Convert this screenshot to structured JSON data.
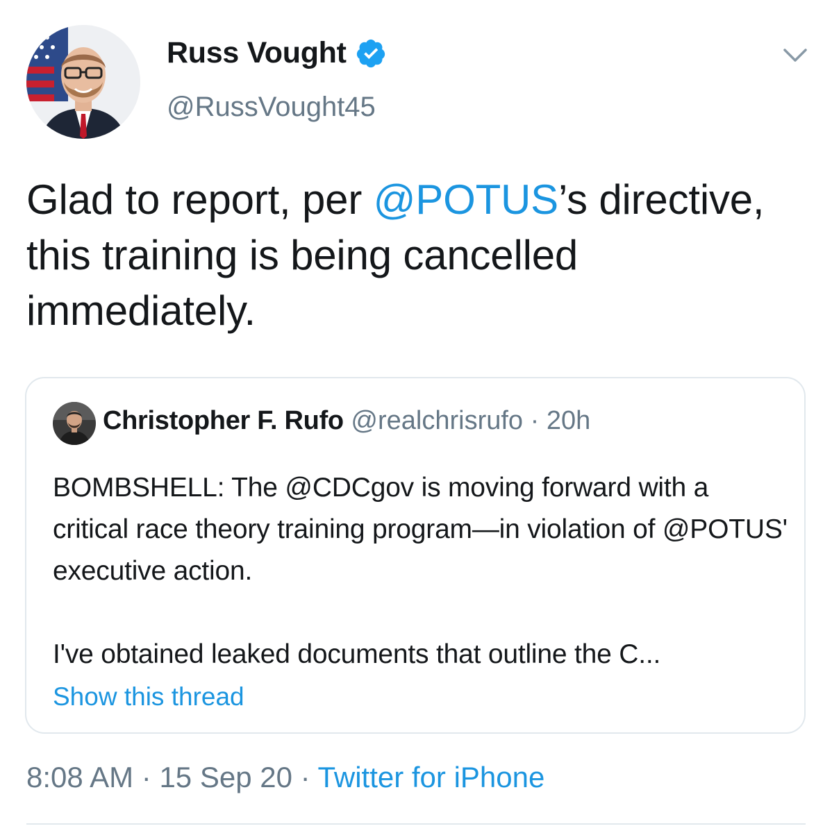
{
  "author": {
    "display_name": "Russ Vought",
    "handle": "@RussVought45",
    "verified_icon": "verified-badge-icon",
    "verified_color": "#1da1f2"
  },
  "tweet": {
    "text_before": "Glad to report, per ",
    "mention": "@POTUS",
    "text_after": "’s directive, this training is being cancelled immediately."
  },
  "quoted_tweet": {
    "display_name": "Christopher F. Rufo",
    "handle": "@realchrisrufo",
    "separator": "·",
    "time": "20h",
    "paragraph1": "BOMBSHELL: The @CDCgov is moving forward with a critical race theory training program—in violation of @POTUS' executive action.",
    "paragraph2": "I've obtained leaked documents that outline the C...",
    "show_thread": "Show this thread"
  },
  "meta": {
    "time": "8:08 AM",
    "sep1": " · ",
    "date": "15 Sep 20",
    "sep2": " · ",
    "source": "Twitter for iPhone"
  },
  "colors": {
    "link": "#1b95e0",
    "secondary_text": "#657786",
    "border": "#e1e8ed",
    "primary_text": "#14171a"
  }
}
